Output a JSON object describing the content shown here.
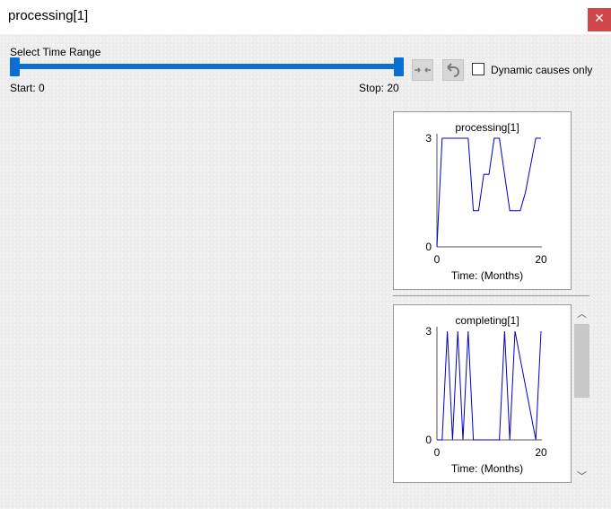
{
  "window": {
    "title": "processing[1]",
    "close_glyph": "✕"
  },
  "controls": {
    "range_label": "Select Time Range",
    "start_text": "Start: 0",
    "stop_text": "Stop: 20",
    "slider": {
      "min": 0,
      "max": 20,
      "start": 0,
      "stop": 20
    },
    "accent_color": "#0a6fd3",
    "collapse_button_icon": "collapse-arrows-icon",
    "undo_button_icon": "undo-arrow-icon",
    "dynamic_causes_label": "Dynamic causes only",
    "dynamic_causes_checked": false
  },
  "scroll": {
    "up_glyph": "︿",
    "down_glyph": "﹀"
  },
  "chart_data": [
    {
      "type": "line",
      "title": "processing[1]",
      "xlabel": "Time: (Months)",
      "ylabel": "",
      "xlim": [
        0,
        20
      ],
      "ylim": [
        0,
        3
      ],
      "xticks": [
        "0",
        "20"
      ],
      "yticks": [
        "0",
        "3"
      ],
      "line_color": "#0000cc",
      "x": [
        0,
        1,
        6,
        7,
        8,
        9,
        10,
        11,
        12,
        14,
        15,
        16,
        17,
        19,
        20
      ],
      "y": [
        0,
        3,
        3,
        1,
        1,
        2,
        2,
        3,
        3,
        1,
        1,
        1,
        1.5,
        3,
        3
      ]
    },
    {
      "type": "line",
      "title": "completing[1]",
      "xlabel": "Time: (Months)",
      "ylabel": "",
      "xlim": [
        0,
        20
      ],
      "ylim": [
        0,
        3
      ],
      "xticks": [
        "0",
        "20"
      ],
      "yticks": [
        "0",
        "3"
      ],
      "line_color": "#0000cc",
      "x": [
        0,
        1,
        2,
        3,
        4,
        5,
        6,
        7,
        8,
        12,
        13,
        14,
        15,
        19,
        20
      ],
      "y": [
        0,
        0,
        3,
        0,
        3,
        0,
        3,
        0,
        0,
        0,
        3,
        0,
        3,
        0,
        3
      ]
    }
  ]
}
